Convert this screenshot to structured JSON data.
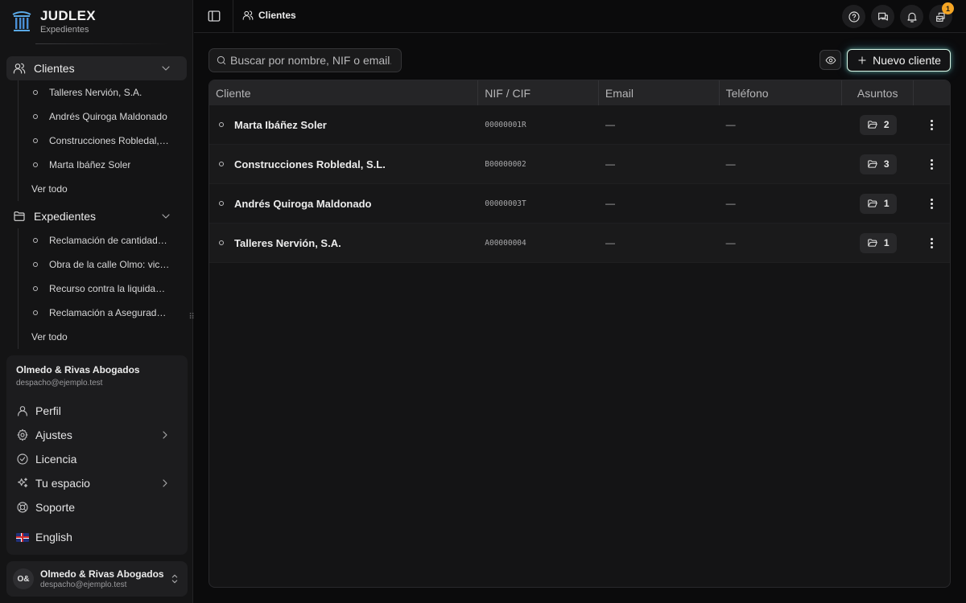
{
  "brand": {
    "name": "JUDLEX",
    "subtitle": "Expedientes"
  },
  "sidebar": {
    "clients": {
      "label": "Clientes",
      "items": [
        "Talleres Nervión, S.A.",
        "Andrés Quiroga Maldonado",
        "Construcciones Robledal, S.L.",
        "Marta Ibáñez Soler"
      ],
      "more": "Ver todo"
    },
    "cases": {
      "label": "Expedientes",
      "items": [
        "Reclamación de cantidad por obras",
        "Obra de la calle Olmo: vicios ocultos",
        "Recurso contra la liquidación",
        "Reclamación a Aseguradora"
      ],
      "more": "Ver todo"
    }
  },
  "account": {
    "org": "Olmedo & Rivas Abogados",
    "email": "despacho@ejemplo.test",
    "menu": {
      "profile": "Perfil",
      "settings": "Ajustes",
      "license": "Licencia",
      "workspace": "Tu espacio",
      "support": "Soporte"
    },
    "language": "English"
  },
  "user_footer": {
    "initials": "O&",
    "name": "Olmedo & Rivas Abogados",
    "email": "despacho@ejemplo.test"
  },
  "header": {
    "breadcrumb": "Clientes",
    "notification_badge": "1"
  },
  "toolbar": {
    "search_placeholder": "Buscar por nombre, NIF o email.",
    "new_client": "Nuevo cliente"
  },
  "table": {
    "columns": {
      "name": "Cliente",
      "nif": "NIF / CIF",
      "email": "Email",
      "phone": "Teléfono",
      "cases": "Asuntos"
    },
    "rows": [
      {
        "name": "Marta Ibáñez Soler",
        "nif": "00000001R",
        "email": "—",
        "phone": "—",
        "cases": "2"
      },
      {
        "name": "Construcciones Robledal, S.L.",
        "nif": "B00000002",
        "email": "—",
        "phone": "—",
        "cases": "3"
      },
      {
        "name": "Andrés Quiroga Maldonado",
        "nif": "00000003T",
        "email": "—",
        "phone": "—",
        "cases": "1"
      },
      {
        "name": "Talleres Nervión, S.A.",
        "nif": "A00000004",
        "email": "—",
        "phone": "—",
        "cases": "1"
      }
    ]
  },
  "colors": {
    "background": "#0b0b0c",
    "sidebar": "#141415",
    "badge": "#f5a524",
    "accent_glow": "#82e6c8"
  },
  "icons": [
    "logo-columns-icon",
    "users-icon",
    "folder-icon",
    "chevron-down-icon",
    "chevron-right-icon",
    "chevron-updown-icon",
    "user-icon",
    "gear-icon",
    "check-circle-icon",
    "sparkles-icon",
    "lifebuoy-icon",
    "uk-flag-icon",
    "sidebar-toggle-icon",
    "help-icon",
    "chat-icon",
    "bell-icon",
    "inbox-icon",
    "search-icon",
    "eye-icon",
    "plus-icon",
    "kebab-icon"
  ]
}
